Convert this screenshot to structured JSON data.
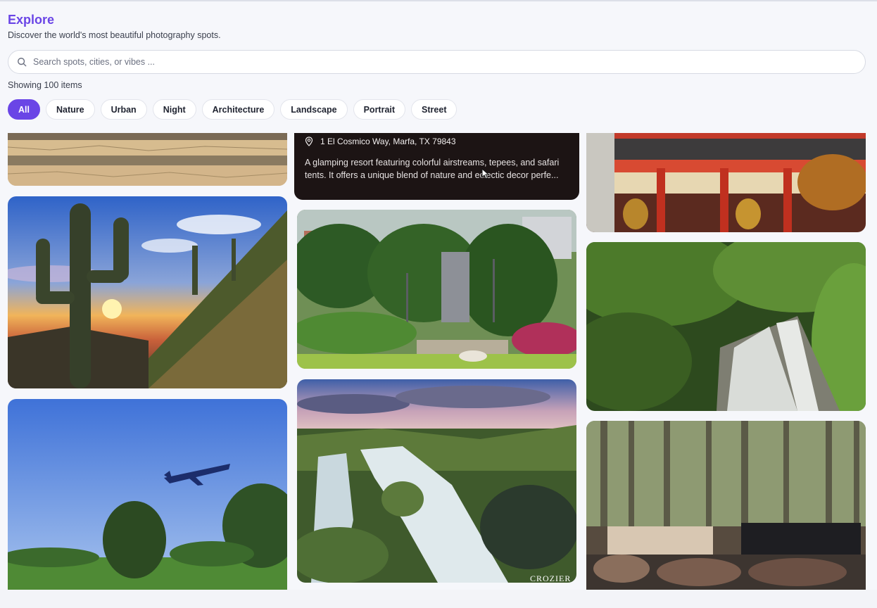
{
  "header": {
    "title": "Explore",
    "subtitle": "Discover the world's most beautiful photography spots."
  },
  "search": {
    "placeholder": "Search spots, cities, or vibes ...",
    "value": ""
  },
  "results": {
    "count_text": "Showing 100 items"
  },
  "filters": {
    "chips": [
      "All",
      "Nature",
      "Urban",
      "Night",
      "Architecture",
      "Landscape",
      "Portrait",
      "Street"
    ],
    "active": "All"
  },
  "hover_card": {
    "address": "1 El Cosmico Way, Marfa, TX 79843",
    "description": "A glamping resort featuring colorful airstreams, tepees, and safari tents. It offers a unique blend of nature and eclectic decor perfe..."
  },
  "photos": {
    "waterfall_watermark": "CROZIER"
  },
  "colors": {
    "accent": "#6a45e6",
    "background": "#f6f7fb",
    "overlay": "#1c1414"
  }
}
